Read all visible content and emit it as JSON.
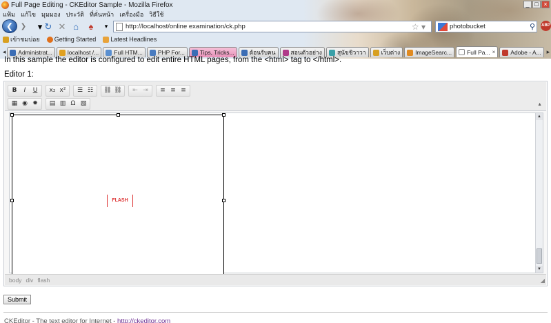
{
  "browser": {
    "title": "Full Page Editing - CKEditor Sample - Mozilla Firefox",
    "menu": [
      "แฟ้ม",
      "แก้ไข",
      "มุมมอง",
      "ประวัติ",
      "ที่คั่นหน้า",
      "เครื่องมือ",
      "วิธีใช้"
    ],
    "url": "http://localhost/online examination/ck.php",
    "search_value": "photobucket",
    "bookmarks": [
      "เข้าชมบ่อย",
      "Getting Started",
      "Latest Headlines"
    ],
    "tabs": [
      {
        "label": "Administrat...",
        "color": "#3b6db5"
      },
      {
        "label": "localhost /...",
        "color": "#e0a020"
      },
      {
        "label": "Full HTM...",
        "color": "#5a8fd0"
      },
      {
        "label": "PHP For...",
        "color": "#4a7cc0"
      },
      {
        "label": "Tips, Tricks...",
        "color": "#3b6db5",
        "pink": true
      },
      {
        "label": "ต้อนรับคน",
        "color": "#3b6db5"
      },
      {
        "label": "สอนตัวอย่าง",
        "color": "#b03a8a"
      },
      {
        "label": "สุนัขชิวาวา",
        "color": "#3aa0a8"
      },
      {
        "label": "เว็บต่าง",
        "color": "#d8a020"
      },
      {
        "label": "ImageSearc...",
        "color": "#e08a20"
      },
      {
        "label": "Full Pa...",
        "color": "#ffffff",
        "active": true,
        "close": "×"
      },
      {
        "label": "Adobe - A...",
        "color": "#c0392b"
      }
    ]
  },
  "page": {
    "intro": "In this sample the editor is configured to edit entire HTML pages, from the <html> tag to </html>.",
    "editor_label": "Editor 1:",
    "flash_label": "FLASH",
    "elements_path": [
      "body",
      "div",
      "flash"
    ],
    "submit_label": "Submit",
    "footer_text": "CKEditor - The text editor for Internet - ",
    "footer_link": "http://ckeditor.com"
  },
  "toolbar": {
    "row1": [
      [
        "B",
        "I",
        "U"
      ],
      [
        "x₂",
        "x²"
      ],
      [
        "☰",
        "☷"
      ],
      [
        "⛓",
        "⛓"
      ],
      [
        "⇤",
        "⇥"
      ],
      [
        "≡",
        "≡",
        "≡"
      ]
    ],
    "row2": [
      [
        "▦",
        "◉",
        "✹"
      ],
      [
        "▤",
        "▥",
        "Ω",
        "▧"
      ]
    ]
  }
}
